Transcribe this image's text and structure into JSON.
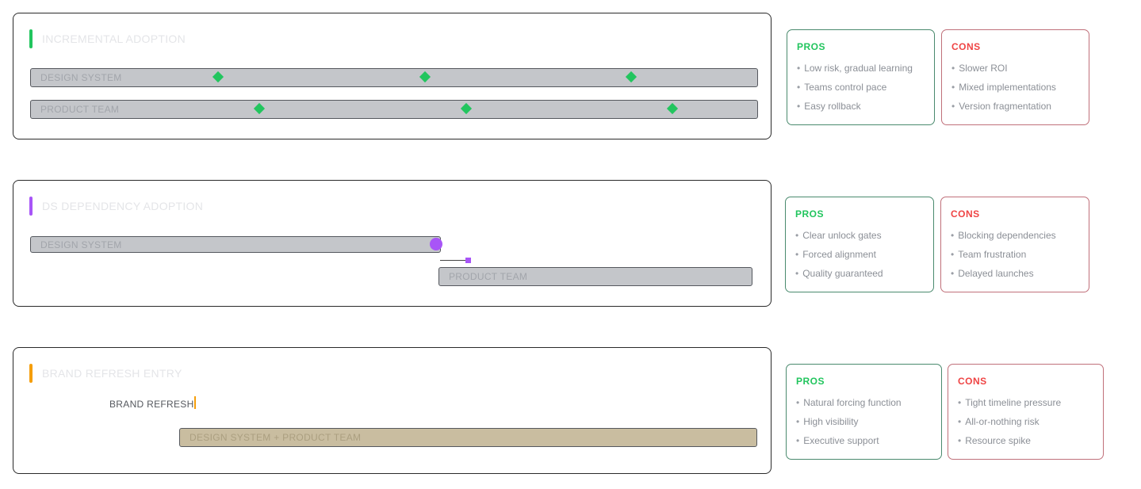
{
  "colors": {
    "green": "#22c55e",
    "purple": "#a855f7",
    "orange": "#f59e0b",
    "pros": "#22c55e",
    "cons": "#ef4444"
  },
  "sections": [
    {
      "title": "INCREMENTAL ADOPTION",
      "bars": [
        "DESIGN SYSTEM",
        "PRODUCT TEAM"
      ],
      "pros": {
        "title": "PROS",
        "items": [
          "Low risk, gradual learning",
          "Teams control pace",
          "Easy rollback"
        ]
      },
      "cons": {
        "title": "CONS",
        "items": [
          "Slower ROI",
          "Mixed implementations",
          "Version fragmentation"
        ]
      }
    },
    {
      "title": "DS DEPENDENCY ADOPTION",
      "bars": [
        "DESIGN SYSTEM",
        "PRODUCT TEAM"
      ],
      "pros": {
        "title": "PROS",
        "items": [
          "Clear unlock gates",
          "Forced alignment",
          "Quality guaranteed"
        ]
      },
      "cons": {
        "title": "CONS",
        "items": [
          "Blocking dependencies",
          "Team frustration",
          "Delayed launches"
        ]
      }
    },
    {
      "title": "BRAND REFRESH ENTRY",
      "marker_label": "BRAND REFRESH",
      "bars": [
        "DESIGN SYSTEM + PRODUCT TEAM"
      ],
      "pros": {
        "title": "PROS",
        "items": [
          "Natural forcing function",
          "High visibility",
          "Executive support"
        ]
      },
      "cons": {
        "title": "CONS",
        "items": [
          "Tight timeline pressure",
          "All-or-nothing risk",
          "Resource spike"
        ]
      }
    }
  ]
}
